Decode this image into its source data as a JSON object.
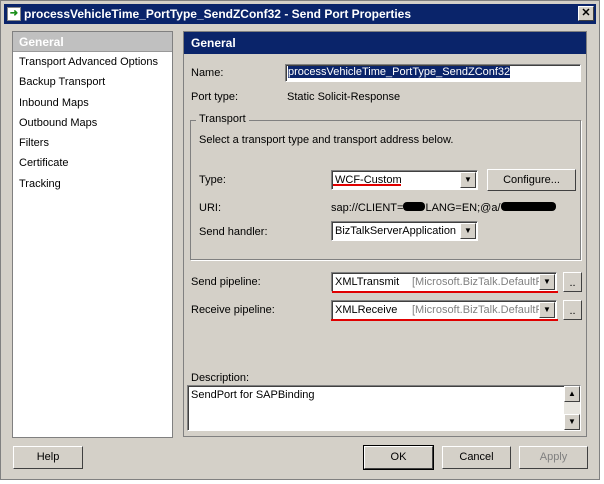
{
  "window": {
    "title": "processVehicleTime_PortType_SendZConf32 - Send Port Properties",
    "close": "✕"
  },
  "nav": {
    "selected": "General",
    "items": [
      "Transport Advanced Options",
      "Backup Transport",
      "Inbound Maps",
      "Outbound Maps",
      "Filters",
      "Certificate",
      "Tracking"
    ]
  },
  "general": {
    "header": "General",
    "name_label": "Name:",
    "name_value": "processVehicleTime_PortType_SendZConf32",
    "port_type_label": "Port type:",
    "port_type_value": "Static Solicit-Response",
    "transport": {
      "title": "Transport",
      "hint": "Select a transport type and transport address below.",
      "type_label": "Type:",
      "type_value": "WCF-Custom",
      "configure": "Configure...",
      "uri_label": "URI:",
      "uri_value": "sap://CLIENT=",
      "uri_value2": "LANG=EN;@a/",
      "handler_label": "Send handler:",
      "handler_value": "BizTalkServerApplication"
    },
    "send_pipeline_label": "Send pipeline:",
    "send_pipeline_value": "XMLTransmit",
    "send_pipeline_assembly": "[Microsoft.BizTalk.DefaultPip",
    "receive_pipeline_label": "Receive pipeline:",
    "receive_pipeline_value": "XMLReceive",
    "receive_pipeline_assembly": "[Microsoft.BizTalk.DefaultPip",
    "browse": "..",
    "description_label": "Description:",
    "description_value": "SendPort for SAPBinding"
  },
  "buttons": {
    "help": "Help",
    "ok": "OK",
    "cancel": "Cancel",
    "apply": "Apply"
  }
}
